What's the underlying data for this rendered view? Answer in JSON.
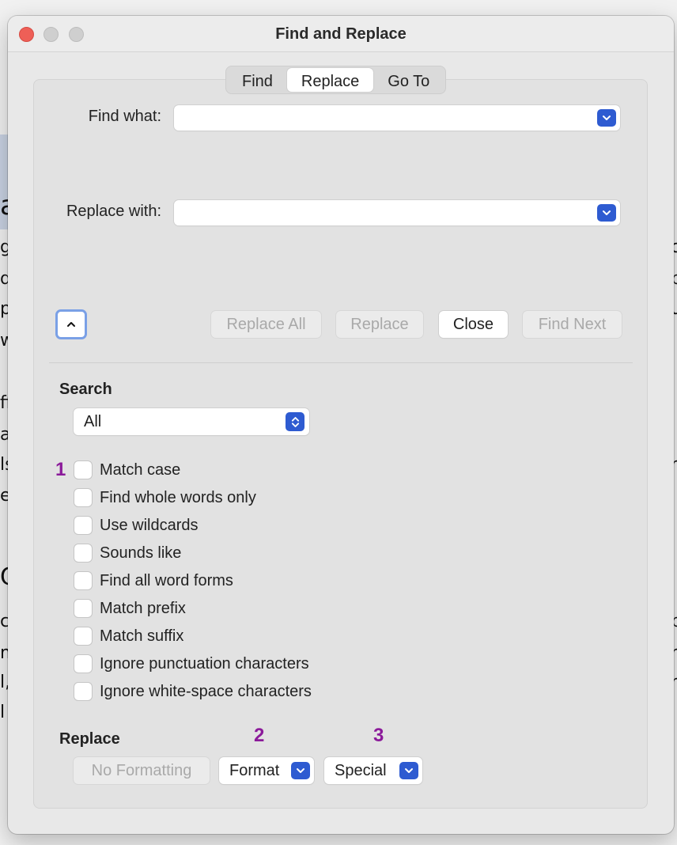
{
  "window": {
    "title": "Find and Replace"
  },
  "tabs": [
    {
      "label": "Find",
      "active": false
    },
    {
      "label": "Replace",
      "active": true
    },
    {
      "label": "Go To",
      "active": false
    }
  ],
  "find": {
    "label": "Find what:",
    "value": ""
  },
  "replace": {
    "label": "Replace with:",
    "value": ""
  },
  "actions": {
    "replace_all": "Replace All",
    "replace": "Replace",
    "close": "Close",
    "find_next": "Find Next"
  },
  "search": {
    "section_title": "Search",
    "selected": "All"
  },
  "options": [
    {
      "label": "Match case",
      "checked": false
    },
    {
      "label": "Find whole words only",
      "checked": false
    },
    {
      "label": "Use wildcards",
      "checked": false
    },
    {
      "label": "Sounds like",
      "checked": false
    },
    {
      "label": "Find all word forms",
      "checked": false
    },
    {
      "label": "Match prefix",
      "checked": false
    },
    {
      "label": "Match suffix",
      "checked": false
    },
    {
      "label": "Ignore punctuation characters",
      "checked": false
    },
    {
      "label": "Ignore white-space characters",
      "checked": false
    }
  ],
  "replace_section": {
    "title": "Replace",
    "no_formatting": "No Formatting",
    "format": "Format",
    "special": "Special"
  },
  "markers": {
    "m1": "1",
    "m2": "2",
    "m3": "3"
  },
  "colors": {
    "accent": "#2e5bd1",
    "marker": "#8b1a9a",
    "close_dot": "#ee5f57"
  },
  "background_doc": {
    "left_chars": [
      "a",
      "g",
      "d",
      "p",
      "w",
      "ff",
      "a",
      "ls",
      "e",
      "C",
      "c",
      "m",
      "l,",
      "l"
    ],
    "right_chars": [
      "c",
      "p",
      "u",
      "r",
      "p",
      "n",
      "n"
    ]
  }
}
